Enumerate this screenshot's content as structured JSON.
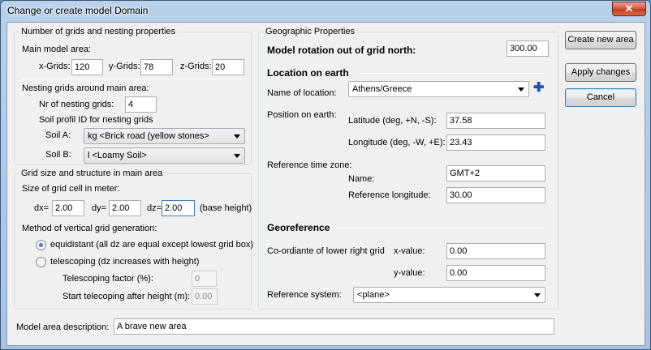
{
  "window": {
    "title": "Change or create model Domain",
    "close_glyph": "✕"
  },
  "grids": {
    "legend": "Number of grids and nesting properties",
    "main_area_label": "Main model area:",
    "x_label": "x-Grids:",
    "x_value": "120",
    "y_label": "y-Grids:",
    "y_value": "78",
    "z_label": "z-Grids:",
    "z_value": "20",
    "nesting_label": "Nesting grids around main area:",
    "nr_label": "Nr of nesting grids:",
    "nr_value": "4",
    "soil_profile_label": "Soil profil ID for nesting grids",
    "soil_a_label": "Soil A:",
    "soil_a_value": "kg <Brick road (yellow stones>",
    "soil_b_label": "Soil B:",
    "soil_b_value": "l <Loamy Soil>"
  },
  "gridsize": {
    "legend": "Grid size and structure in main area",
    "cell_label": "Size of grid cell in meter:",
    "dx_label": "dx=",
    "dx_value": "2.00",
    "dy_label": "dy=",
    "dy_value": "2.00",
    "dz_label": "dz=",
    "dz_value": "2.00",
    "base_height": "(base height)",
    "method_label": "Method of vertical grid generation:",
    "equidistant_label": "equidistant (all dz are equal except lowest grid box)",
    "telescoping_label": "telescoping (dz increases with height)",
    "tele_factor_label": "Telescoping factor (%):",
    "tele_factor_value": "0",
    "tele_start_label": "Start telecoping after height (m):",
    "tele_start_value": "0.00"
  },
  "geo": {
    "legend": "Geographic Properties",
    "rotation_label": "Model rotation out of grid north:",
    "rotation_value": "300.00",
    "location_heading": "Location on earth",
    "name_label": "Name of location:",
    "name_value": "Athens/Greece",
    "position_label": "Position on earth:",
    "lat_label": "Latitude (deg, +N, -S):",
    "lat_value": "37.58",
    "lon_label": "Longitude (deg, -W, +E):",
    "lon_value": "23.43",
    "tz_label": "Reference time zone:",
    "tz_name_label": "Name:",
    "tz_name_value": "GMT+2",
    "ref_lon_label": "Reference longitude:",
    "ref_lon_value": "30.00",
    "georef_heading": "Georeference",
    "corner_label": "Co-ordiante of lower right grid",
    "x_label": "x-value:",
    "x_value": "0.00",
    "y_label": "y-value:",
    "y_value": "0.00",
    "refsys_label": "Reference system:",
    "refsys_value": "<plane>"
  },
  "buttons": {
    "create": "Create new area",
    "apply": "Apply changes",
    "cancel": "Cancel"
  },
  "description": {
    "label": "Model area description:",
    "value": "A brave new area"
  },
  "colors": {
    "accent": "#1e4fb4",
    "title_bar": "#b9d1ea",
    "close_button": "#c13b22"
  }
}
